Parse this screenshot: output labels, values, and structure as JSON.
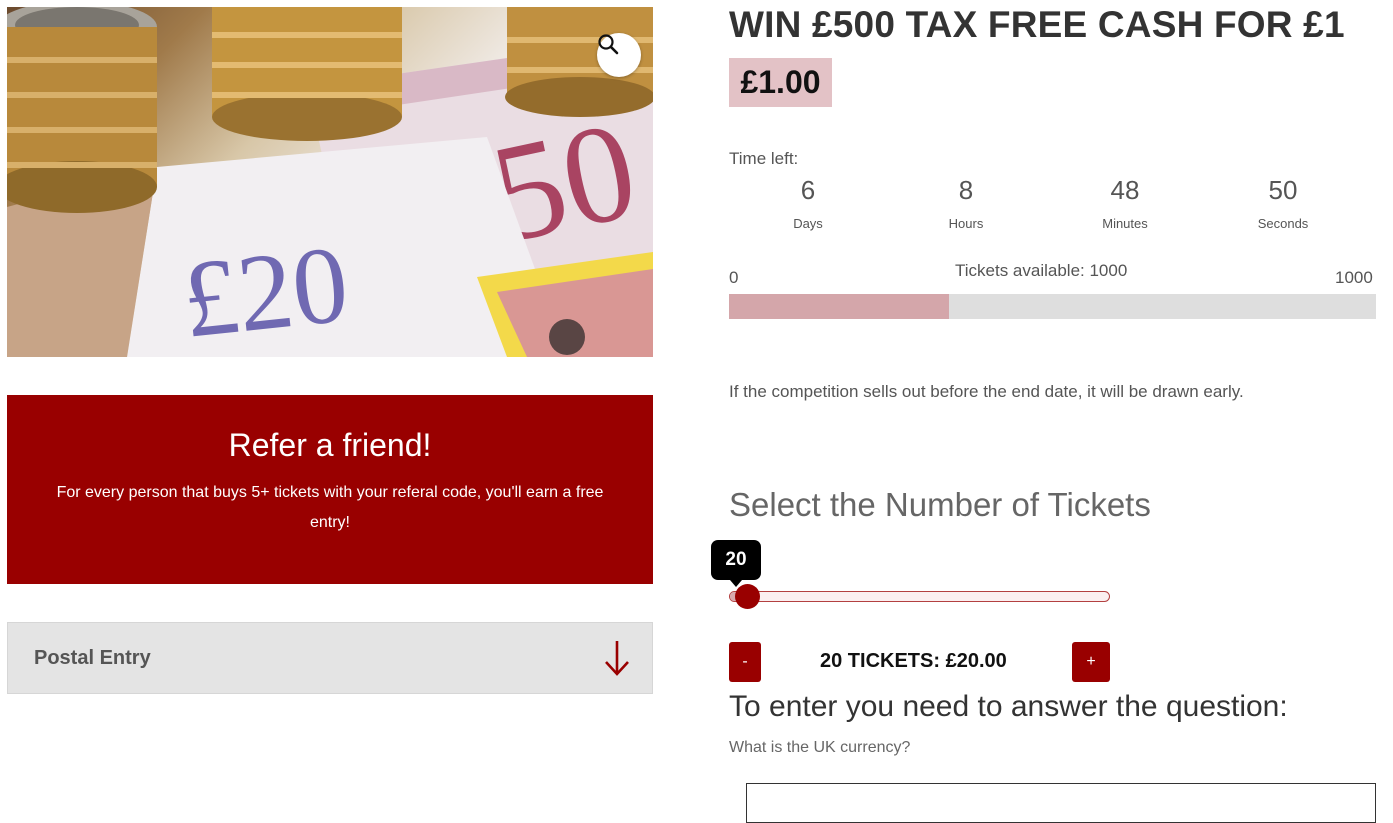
{
  "product": {
    "title": "WIN £500 TAX FREE CASH FOR £1",
    "price": "£1.00",
    "image_icon": "zoom-magnifier-icon"
  },
  "countdown": {
    "label": "Time left:",
    "units": [
      {
        "value": "6",
        "label": "Days"
      },
      {
        "value": "8",
        "label": "Hours"
      },
      {
        "value": "48",
        "label": "Minutes"
      },
      {
        "value": "50",
        "label": "Seconds"
      }
    ]
  },
  "tickets": {
    "min": "0",
    "available_text": "Tickets available: 1000",
    "max": "1000",
    "sold_fraction": 0.34
  },
  "sellout_notice": "If the competition sells out before the end date, it will be drawn early.",
  "selector": {
    "heading": "Select the Number of Tickets",
    "slider_value": "20",
    "slider_fraction": 0.02,
    "minus_label": "-",
    "plus_label": "+",
    "summary": "20 TICKETS: £20.00"
  },
  "question": {
    "heading": "To enter you need to answer the question:",
    "text": "What is the UK currency?",
    "answer_value": ""
  },
  "refer": {
    "title": "Refer a friend!",
    "text": "For every person that buys 5+ tickets with your referal code, you'll earn a free entry!"
  },
  "postal": {
    "label": "Postal Entry",
    "icon": "arrow-down-icon"
  },
  "colors": {
    "accent": "#990000",
    "price_bg": "#e3c2c6",
    "progress_fill": "#d4a6aa",
    "progress_track": "#dedede",
    "postal_bg": "#e4e4e4"
  }
}
